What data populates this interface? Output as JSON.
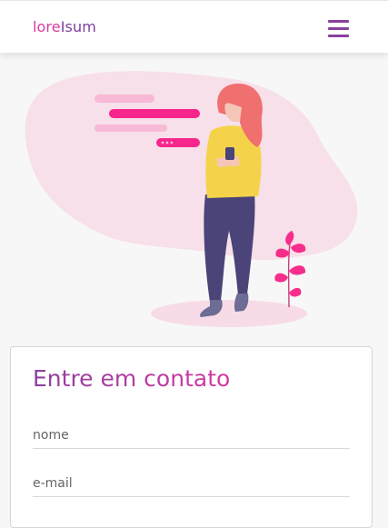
{
  "navbar": {
    "brand_part1": "lore",
    "brand_part2": "Isum",
    "menu_icon": "hamburger-menu-icon"
  },
  "hero": {
    "illustration": "woman-texting-illustration",
    "colors": {
      "blob": "#f7e0ea",
      "bubble_light": "#f7b9d5",
      "bubble_strong": "#f7268c",
      "hair": "#f06f6f",
      "shirt": "#f4d34a",
      "pants": "#4a4478",
      "plant": "#f72d8c"
    }
  },
  "contact": {
    "title": "Entre em contato",
    "name_placeholder": "nome",
    "email_placeholder": "e-mail"
  }
}
